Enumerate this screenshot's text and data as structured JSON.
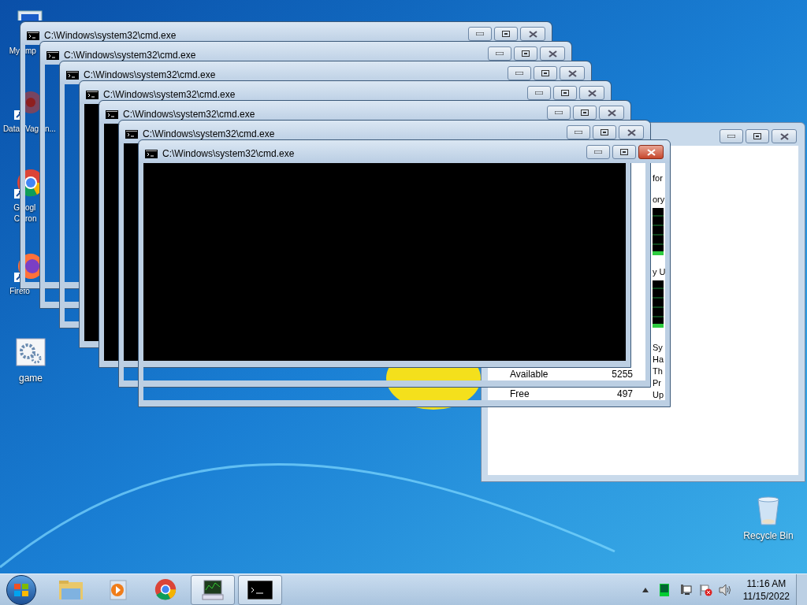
{
  "desktop_icons": [
    {
      "label_lines": [
        [
          "My",
          "mp"
        ]
      ],
      "kind": "computer",
      "shortcut": false,
      "covered": true
    },
    {
      "label_lines": [
        [
          "Data",
          "Vag",
          "n..."
        ]
      ],
      "kind": "app",
      "shortcut": true,
      "covered": true
    },
    {
      "label_lines": [
        [
          "G",
          "ogl"
        ],
        [
          "C",
          "ron"
        ]
      ],
      "kind": "chrome",
      "shortcut": true,
      "covered": true
    },
    {
      "label_lines": [
        [
          "Firefo"
        ]
      ],
      "kind": "firefox",
      "shortcut": true,
      "covered": true
    },
    {
      "label_lines": [
        [
          "game"
        ]
      ],
      "kind": "settings",
      "shortcut": false,
      "covered": false
    },
    {
      "label_lines": [
        [
          "Recycle Bin"
        ]
      ],
      "kind": "recycle",
      "shortcut": false,
      "covered": false
    }
  ],
  "background_window": {
    "headings": [
      "for",
      "ory",
      "y U"
    ],
    "side_labels": [
      "Sy",
      "Ha",
      "Th",
      "Pr",
      "Up"
    ],
    "rows": [
      {
        "label": "Available",
        "value": "5255"
      },
      {
        "label": "Free",
        "value": "497"
      }
    ]
  },
  "cmd_windows": [
    {
      "title": "C:\\Windows\\system32\\cmd.exe",
      "kind": "blank"
    },
    {
      "title": "C:\\Windows\\system32\\cmd.exe",
      "kind": "blank"
    },
    {
      "title": "C:\\Windows\\system32\\cmd.exe",
      "kind": "blank"
    },
    {
      "title": "C:\\Windows\\system32\\cmd.exe",
      "kind": "console"
    },
    {
      "title": "C:\\Windows\\system32\\cmd.exe",
      "kind": "console"
    },
    {
      "title": "C:\\Windows\\system32\\cmd.exe",
      "kind": "partial"
    },
    {
      "title": "C:\\Windows\\system32\\cmd.exe",
      "kind": "partial"
    }
  ],
  "taskbar": {
    "apps": [
      {
        "kind": "explorer",
        "running": false
      },
      {
        "kind": "media",
        "running": false
      },
      {
        "kind": "chrome",
        "running": false
      },
      {
        "kind": "monitor",
        "running": true
      },
      {
        "kind": "console",
        "running": true
      }
    ],
    "clock": {
      "time": "11:16 AM",
      "date": "11/15/2022"
    }
  }
}
